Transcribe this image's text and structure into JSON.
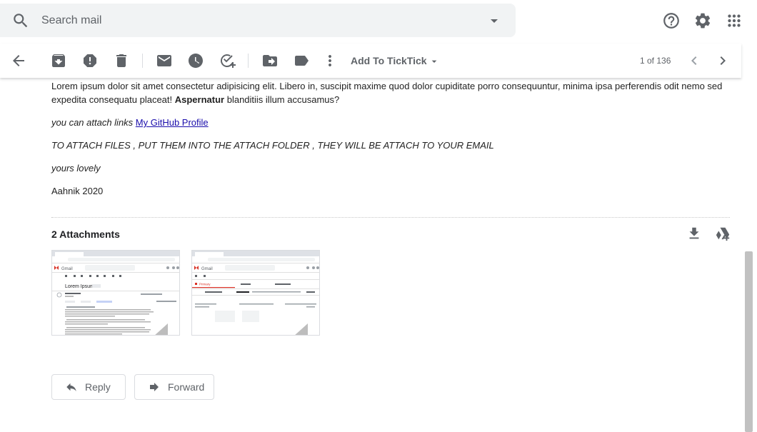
{
  "search": {
    "placeholder": "Search mail"
  },
  "toolbar": {
    "ticktick_label": "Add To TickTick",
    "pager_text": "1 of 136"
  },
  "message": {
    "p1_text": "Lorem ipsum dolor sit amet consectetur adipisicing elit. Libero in, suscipit maxime quod dolor cupiditate porro consequuntur, minima ipsa perferendis odit nemo sed expedita consequatu placeat! ",
    "p1_bold": "Aspernatur",
    "p1_tail": " blanditiis illum accusamus?",
    "link_intro": "you can attach links ",
    "link_text": "My GitHub Profile",
    "attach_note": "TO ATTACH FILES , PUT THEM INTO THE ATTACH FOLDER , THEY WILL BE ATTACH TO YOUR EMAIL",
    "signoff": "yours lovely",
    "signature": "Aahnik 2020"
  },
  "attachments": {
    "title": "2 Attachments",
    "thumb1": {
      "app_label": "Gmail",
      "subject": "Lorem Ipsum"
    },
    "thumb2": {
      "app_label": "Gmail",
      "tab": "Primary"
    }
  },
  "actions": {
    "reply_label": "Reply",
    "forward_label": "Forward"
  },
  "colors": {
    "icon_gray": "#5f6368",
    "link": "#1a0dab",
    "search_bg": "#f1f3f4",
    "gmail_red": "#d93025"
  },
  "icons": [
    "search-icon",
    "search-options-icon",
    "help-icon",
    "settings-icon",
    "apps-icon",
    "back-arrow-icon",
    "archive-icon",
    "report-spam-icon",
    "delete-icon",
    "mark-unread-icon",
    "snooze-icon",
    "add-task-icon",
    "move-to-icon",
    "label-icon",
    "more-icon",
    "chevron-down-icon",
    "prev-page-icon",
    "next-page-icon",
    "download-all-icon",
    "save-to-drive-icon",
    "reply-icon",
    "forward-icon"
  ]
}
